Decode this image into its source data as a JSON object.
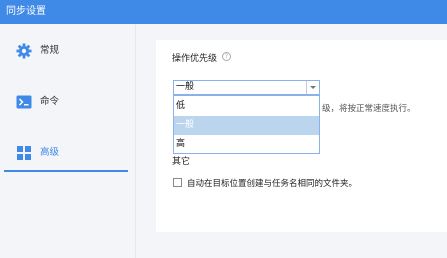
{
  "window": {
    "title": "同步设置"
  },
  "sidebar": {
    "items": [
      {
        "label": "常规",
        "icon": "gear-icon"
      },
      {
        "label": "命令",
        "icon": "terminal-icon"
      },
      {
        "label": "高级",
        "icon": "grid-icon",
        "active": true
      }
    ]
  },
  "priority": {
    "title": "操作优先级",
    "help_glyph": "?",
    "selected": "一般",
    "options": [
      "低",
      "一般",
      "高"
    ],
    "description_tail": "级，将按正常速度执行。"
  },
  "other": {
    "title": "其它",
    "checkbox_label": "自动在目标位置创建与任务名相同的文件夹。",
    "checked": false
  },
  "colors": {
    "accent": "#3f89e7",
    "selection": "#bcd5ef"
  }
}
